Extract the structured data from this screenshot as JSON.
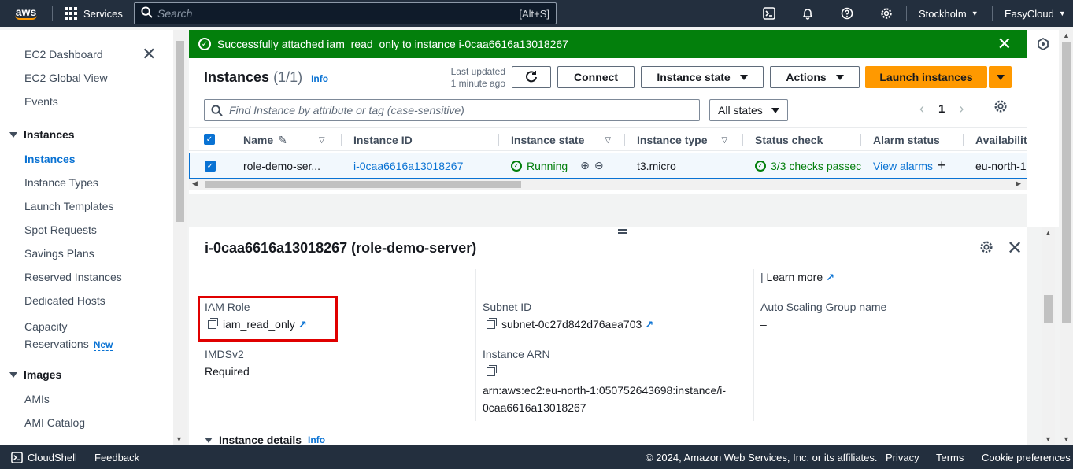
{
  "topnav": {
    "logo": "aws",
    "services": "Services",
    "search_placeholder": "Search",
    "search_shortcut": "[Alt+S]",
    "region": "Stockholm",
    "account": "EasyCloud",
    "icons": [
      "cloudshell-icon",
      "bell-icon",
      "help-icon",
      "gear-icon"
    ]
  },
  "sidebar": {
    "top_items": [
      "EC2 Dashboard",
      "EC2 Global View",
      "Events"
    ],
    "instances_section": "Instances",
    "instances_items": [
      "Instances",
      "Instance Types",
      "Launch Templates",
      "Spot Requests",
      "Savings Plans",
      "Reserved Instances",
      "Dedicated Hosts"
    ],
    "capacity_line1": "Capacity",
    "capacity_line2": "Reservations",
    "new_badge": "New",
    "images_section": "Images",
    "images_items": [
      "AMIs",
      "AMI Catalog"
    ]
  },
  "flash": {
    "message": "Successfully attached iam_read_only to instance i-0caa6616a13018267"
  },
  "instances": {
    "title": "Instances",
    "count": "(1/1)",
    "info": "Info",
    "last_updated_1": "Last updated",
    "last_updated_2": "1 minute ago",
    "connect": "Connect",
    "instance_state": "Instance state",
    "actions": "Actions",
    "launch": "Launch instances",
    "find_placeholder": "Find Instance by attribute or tag (case-sensitive)",
    "all_states": "All states",
    "page": "1",
    "columns": [
      "Name",
      "Instance ID",
      "Instance state",
      "Instance type",
      "Status check",
      "Alarm status",
      "Availabilit"
    ],
    "row": {
      "name": "role-demo-ser...",
      "id": "i-0caa6616a13018267",
      "state": "Running",
      "type": "t3.micro",
      "status": "3/3 checks passec",
      "alarm": "View alarms",
      "az": "eu-north-1"
    }
  },
  "details": {
    "title": "i-0caa6616a13018267 (role-demo-server)",
    "learn_more": "Learn more",
    "iam_role_label": "IAM Role",
    "iam_role_value": "iam_read_only",
    "imds_label": "IMDSv2",
    "imds_value": "Required",
    "subnet_label": "Subnet ID",
    "subnet_value": "subnet-0c27d842d76aea703",
    "arn_label": "Instance ARN",
    "arn_line1": "arn:aws:ec2:eu-north-1:050752643698:instance/i-",
    "arn_line2": "0caa6616a13018267",
    "asg_label": "Auto Scaling Group name",
    "asg_value": "–",
    "instance_details": "Instance details",
    "info": "Info"
  },
  "footer": {
    "cloudshell": "CloudShell",
    "feedback": "Feedback",
    "copyright": "© 2024, Amazon Web Services, Inc. or its affiliates.",
    "privacy": "Privacy",
    "terms": "Terms",
    "cookies": "Cookie preferences"
  },
  "colors": {
    "nav": "#232f3e",
    "success": "#037f0c",
    "primary": "#ff9900",
    "link": "#0972d3",
    "highlight": "#e00000"
  }
}
